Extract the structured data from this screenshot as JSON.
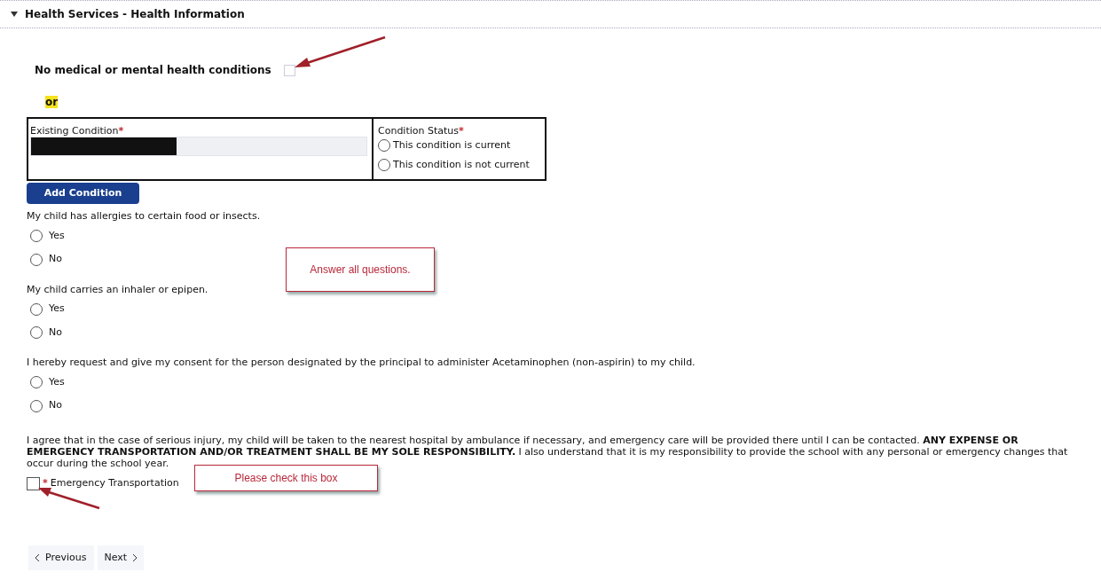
{
  "section": {
    "title": "Health Services - Health Information",
    "expanded": true
  },
  "no_conditions": {
    "label": "No medical or mental health conditions",
    "checked": false
  },
  "or_text": "or",
  "condition_table": {
    "field_label": "Existing Condition",
    "required_mark": "*",
    "status_label": "Condition Status",
    "status_required_mark": "*",
    "status_options": [
      {
        "label": "This condition is current",
        "selected": false
      },
      {
        "label": "This condition is not current",
        "selected": false
      }
    ]
  },
  "add_button": "Add Condition",
  "questions": [
    {
      "text": "My child has allergies to certain food or insects.",
      "options": [
        {
          "label": "Yes",
          "selected": false
        },
        {
          "label": "No",
          "selected": false
        }
      ]
    },
    {
      "text": "My child carries an inhaler or epipen.",
      "options": [
        {
          "label": "Yes",
          "selected": false
        },
        {
          "label": "No",
          "selected": false
        }
      ]
    },
    {
      "text": "I hereby request and give my consent for the person designated by the principal to administer Acetaminophen (non-aspirin) to my child.",
      "options": [
        {
          "label": "Yes",
          "selected": false
        },
        {
          "label": "No",
          "selected": false
        }
      ]
    }
  ],
  "agreement": "I agree that in the case of serious injury, my child will be taken to the nearest hospital by ambulance if necessary, and emergency care will be provided there until I can be contacted. **ANY EXPENSE OR EMERGENCY TRANSPORTATION AND/OR TREATMENT SHALL BE MY SOLE RESPONSIBILITY.** I also understand that it is my responsibility to provide the school with any personal or emergency changes that occur during the school year.",
  "emergency": {
    "required_mark": "*",
    "label": "Emergency Transportation",
    "checked": false
  },
  "callouts": [
    "Answer all questions.",
    "Please check this box"
  ],
  "nav": {
    "previous": "Previous",
    "next": "Next"
  }
}
